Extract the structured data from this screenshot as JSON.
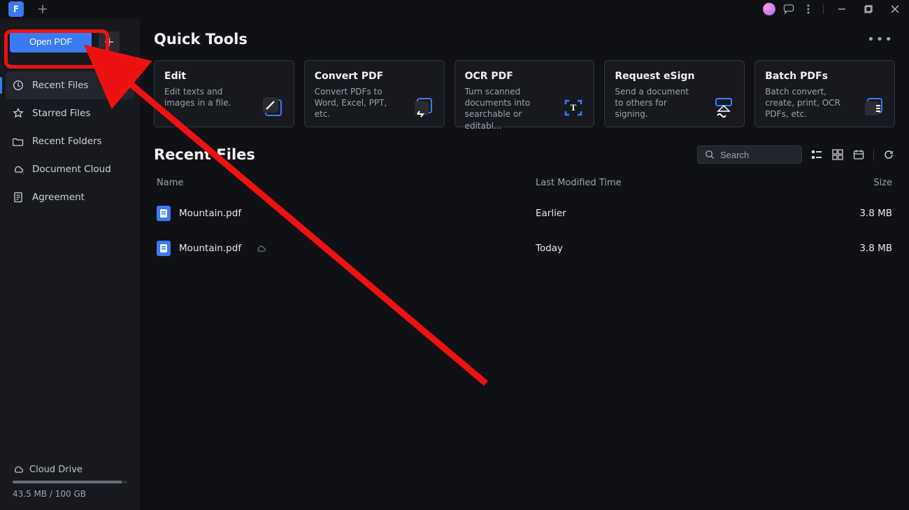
{
  "titlebar": {
    "app_initial": "F"
  },
  "sidebar": {
    "open_label": "Open PDF",
    "items": [
      {
        "label": "Recent Files"
      },
      {
        "label": "Starred Files"
      },
      {
        "label": "Recent Folders"
      },
      {
        "label": "Document Cloud"
      },
      {
        "label": "Agreement"
      }
    ],
    "cloud_title": "Cloud Drive",
    "storage_text": "43.5 MB / 100 GB"
  },
  "quick_tools": {
    "title": "Quick Tools",
    "cards": [
      {
        "title": "Edit",
        "desc": "Edit texts and images in a file."
      },
      {
        "title": "Convert PDF",
        "desc": "Convert PDFs to Word, Excel, PPT, etc."
      },
      {
        "title": "OCR PDF",
        "desc": "Turn scanned documents into searchable or editabl..."
      },
      {
        "title": "Request eSign",
        "desc": "Send a document to others for signing."
      },
      {
        "title": "Batch PDFs",
        "desc": "Batch convert, create, print, OCR PDFs, etc."
      }
    ]
  },
  "recent": {
    "title": "Recent Files",
    "search_placeholder": "Search",
    "columns": {
      "name": "Name",
      "time": "Last Modified Time",
      "size": "Size"
    },
    "files": [
      {
        "name": "Mountain.pdf",
        "time": "Earlier",
        "size": "3.8 MB",
        "cloud": false
      },
      {
        "name": "Mountain.pdf",
        "time": "Today",
        "size": "3.8 MB",
        "cloud": true
      }
    ]
  }
}
